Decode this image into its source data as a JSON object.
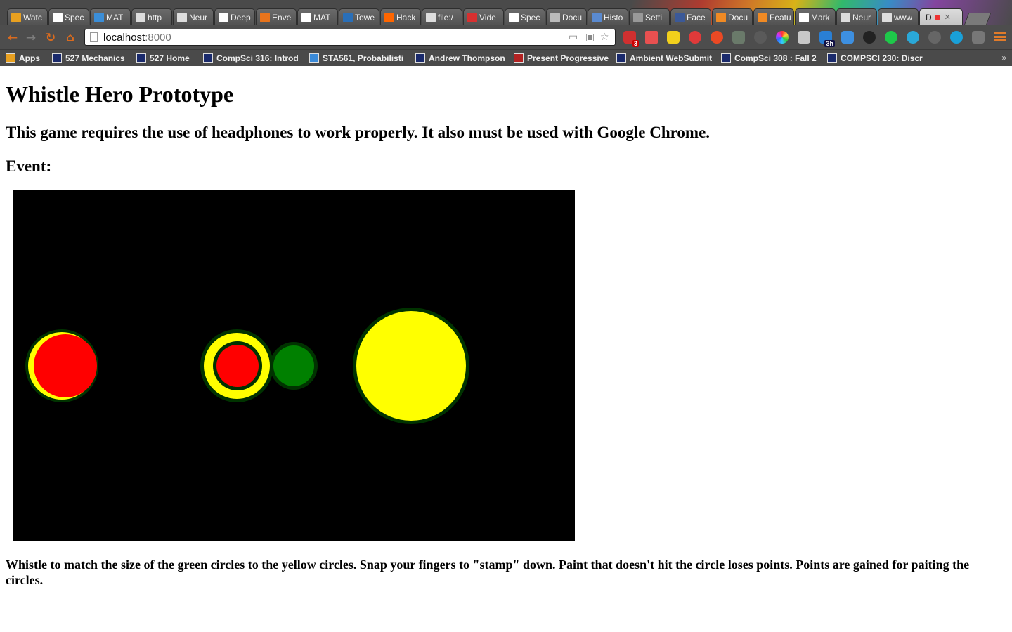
{
  "browser": {
    "tabs": [
      {
        "label": "Watc",
        "favicon": "oo-icon",
        "color": "#e8a020"
      },
      {
        "label": "Spec",
        "favicon": "wikipedia-icon",
        "color": "#ffffff"
      },
      {
        "label": "MAT",
        "favicon": "p-icon",
        "color": "#3b8ed8"
      },
      {
        "label": "http",
        "favicon": "page-icon",
        "color": "#dddddd"
      },
      {
        "label": "Neur",
        "favicon": "page-icon",
        "color": "#dddddd"
      },
      {
        "label": "Deep",
        "favicon": "wikipedia-icon",
        "color": "#ffffff"
      },
      {
        "label": "Enve",
        "favicon": "firefox-icon",
        "color": "#e8741c"
      },
      {
        "label": "MAT",
        "favicon": "shield-icon",
        "color": "#ffffff"
      },
      {
        "label": "Towe",
        "favicon": "c-icon",
        "color": "#2a6fb8"
      },
      {
        "label": "Hack",
        "favicon": "y-icon",
        "color": "#ff6600"
      },
      {
        "label": "file:/",
        "favicon": "page-icon",
        "color": "#dddddd"
      },
      {
        "label": "Vide",
        "favicon": "gear-icon",
        "color": "#d83030"
      },
      {
        "label": "Spec",
        "favicon": "wikipedia-icon",
        "color": "#ffffff"
      },
      {
        "label": "Docu",
        "favicon": "globe-icon",
        "color": "#bbbbbb"
      },
      {
        "label": "Histo",
        "favicon": "h-icon",
        "color": "#5a8ad0"
      },
      {
        "label": "Setti",
        "favicon": "wrench-icon",
        "color": "#999999"
      },
      {
        "label": "Face",
        "favicon": "facebook-icon",
        "color": "#3b5998"
      },
      {
        "label": "Docu",
        "favicon": "grid-icon",
        "color": "#f08a24"
      },
      {
        "label": "Featu",
        "favicon": "grid-icon",
        "color": "#f08a24"
      },
      {
        "label": "Mark",
        "favicon": "wikipedia-icon",
        "color": "#ffffff"
      },
      {
        "label": "Neur",
        "favicon": "page-icon",
        "color": "#dddddd"
      },
      {
        "label": "www",
        "favicon": "page-icon",
        "color": "#dddddd"
      },
      {
        "label": "D",
        "favicon": "none",
        "color": "#dcdcdc",
        "active": true
      }
    ],
    "url_host": "localhost",
    "url_port": ":8000",
    "mail_badge": "3",
    "calendar_badge": "3h"
  },
  "bookmarks": [
    {
      "label": "Apps",
      "icon": "apps-grid-icon"
    },
    {
      "label": "527 Mechanics",
      "icon": "shield-icon"
    },
    {
      "label": "527 Home",
      "icon": "shield-icon"
    },
    {
      "label": "CompSci 316: Introd",
      "icon": "shield-icon"
    },
    {
      "label": "STA561, Probabilisti",
      "icon": "plane-icon"
    },
    {
      "label": "Andrew Thompson",
      "icon": "shield-icon"
    },
    {
      "label": "Present Progressive",
      "icon": "ss-icon"
    },
    {
      "label": "Ambient WebSubmit",
      "icon": "shield-icon"
    },
    {
      "label": "CompSci 308 : Fall 2",
      "icon": "shield-icon"
    },
    {
      "label": "COMPSCI 230: Discr",
      "icon": "shield-icon"
    }
  ],
  "page": {
    "title": "Whistle Hero Prototype",
    "warning": "This game requires the use of headphones to work properly. It also must be used with Google Chrome.",
    "event_label": "Event:",
    "instructions": "Whistle to match the size of the green circles to the yellow circles. Snap your fingers to \"stamp\" down. Paint that doesn't hit the circle loses points. Points are gained for paiting the circles."
  },
  "game": {
    "background": "#000000",
    "yellow": "#ffff00",
    "red": "#ff0000",
    "green": "#008000",
    "outline": "#003300",
    "circles": [
      {
        "name": "painted-circle-left",
        "fill": "yellow",
        "inner": "red"
      },
      {
        "name": "target-circle-ring",
        "fill": "yellow",
        "inner": "red"
      },
      {
        "name": "player-green-circle",
        "fill": "green"
      },
      {
        "name": "target-yellow-circle",
        "fill": "yellow"
      }
    ]
  }
}
